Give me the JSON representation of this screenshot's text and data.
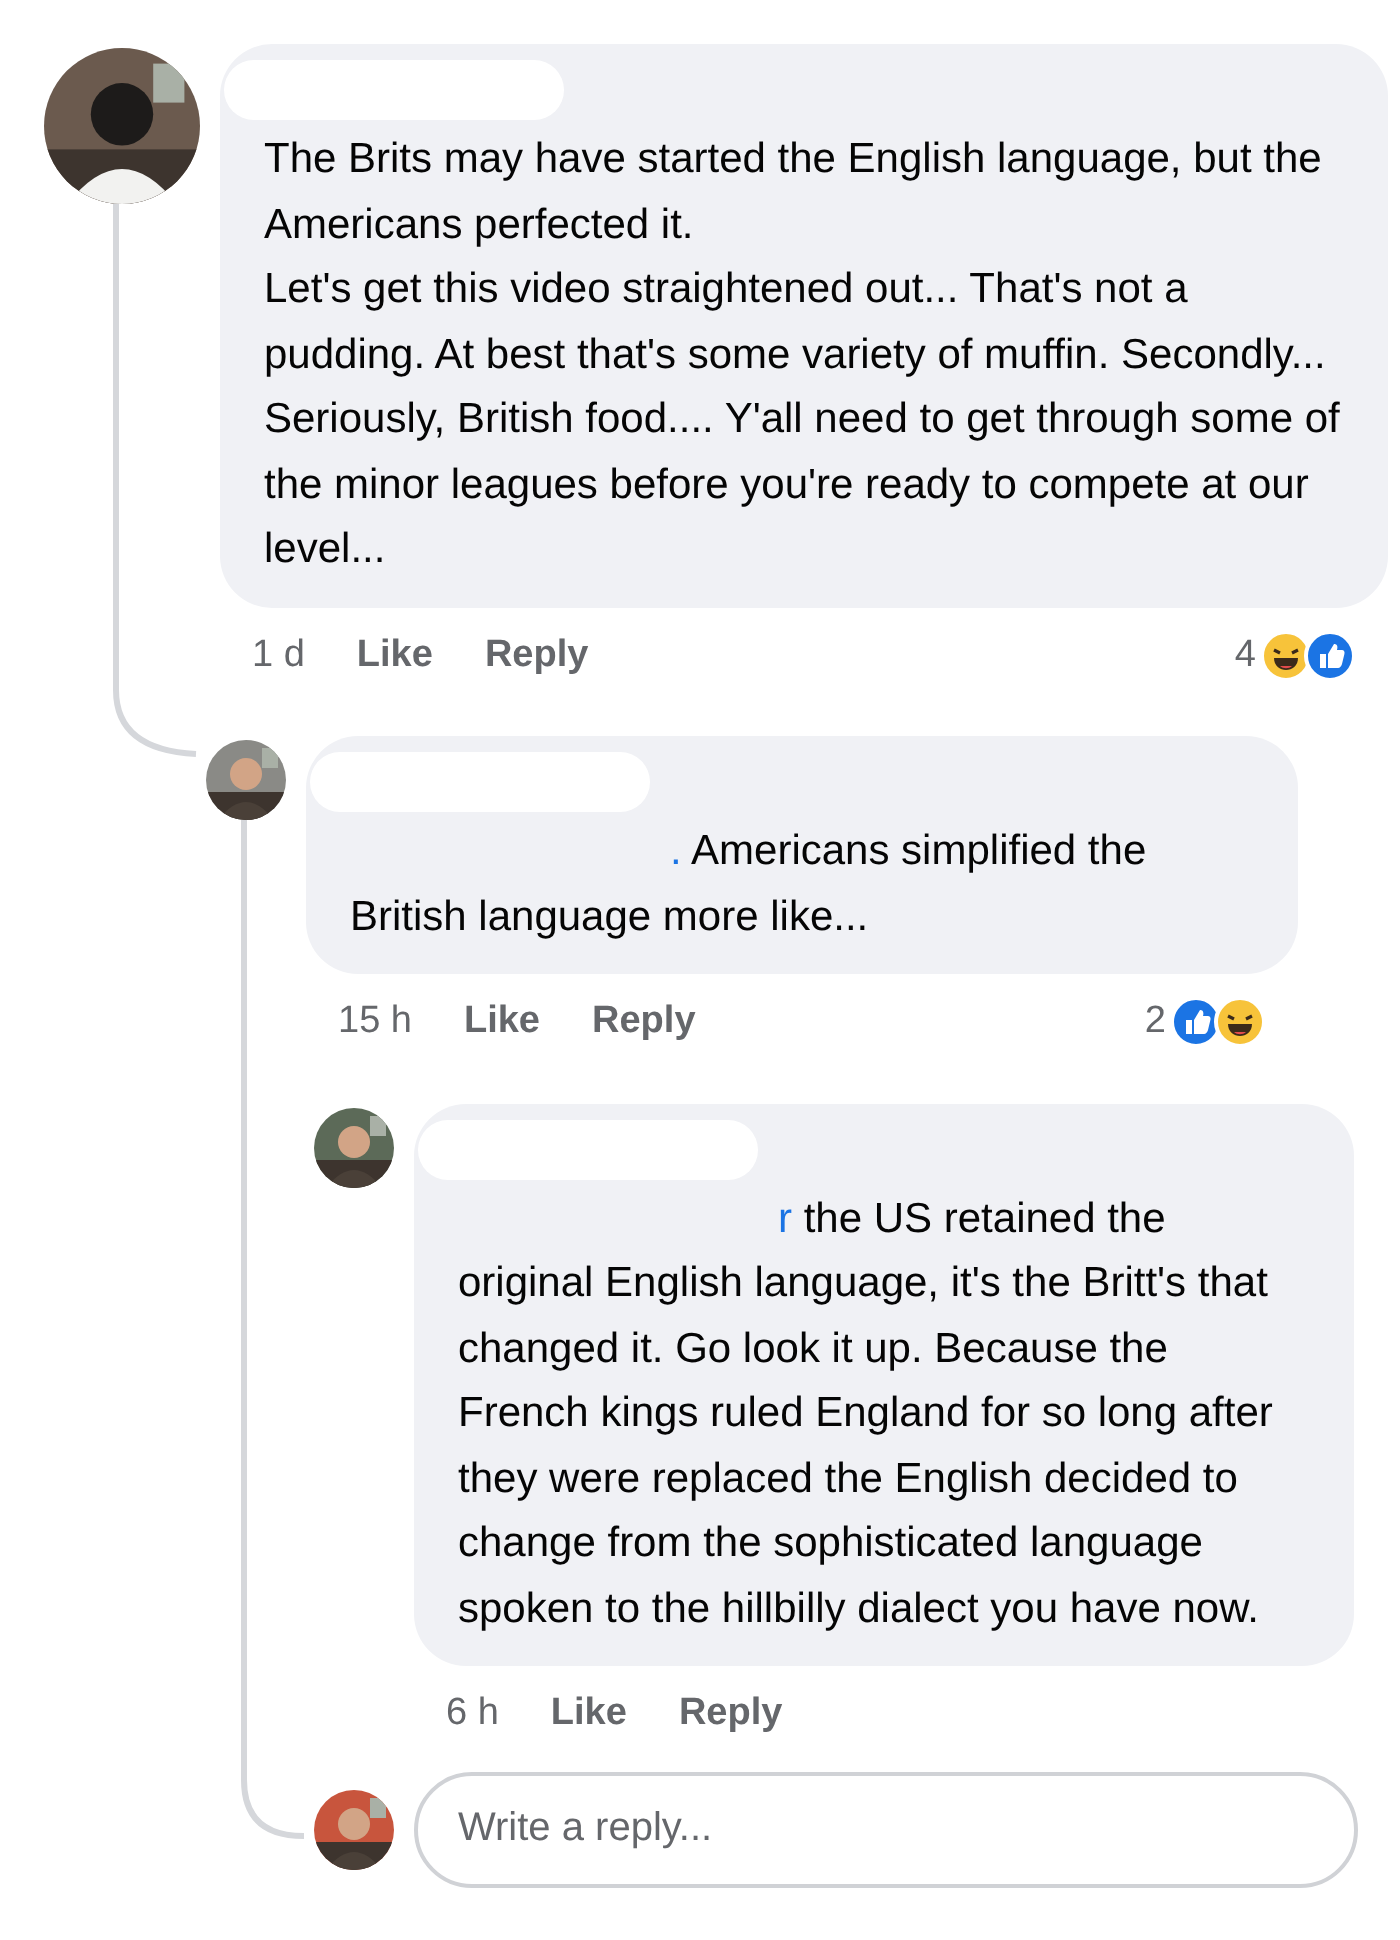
{
  "comments": [
    {
      "paragraphs": [
        "The Brits may have started the English language, but the Americans perfected it.",
        "Let's get this video straightened out... That's not a pudding. At best that's some variety of muffin. Secondly... Seriously, British food.... Y'all need to get through some of the minor leagues before you're ready to compete at our level..."
      ],
      "time": "1 d",
      "like": "Like",
      "reply": "Reply",
      "reaction_count": "4",
      "reactions": [
        {
          "kind": "haha"
        },
        {
          "kind": "like"
        }
      ]
    },
    {
      "mention": ".",
      "paragraphs": [
        "Americans simplified the British language more like..."
      ],
      "time": "15 h",
      "like": "Like",
      "reply": "Reply",
      "reaction_count": "2",
      "reactions": [
        {
          "kind": "like"
        },
        {
          "kind": "haha"
        }
      ]
    },
    {
      "mention": "r",
      "paragraphs": [
        "the US retained the original English language, it's the Britt's that changed it.  Go look it up. Because the French kings ruled England for so long after they were replaced the English decided to change from the sophisticated language spoken to the hillbilly dialect you have now."
      ],
      "time": "6 h",
      "like": "Like",
      "reply": "Reply"
    }
  ],
  "reply_box": {
    "placeholder": "Write a reply..."
  }
}
